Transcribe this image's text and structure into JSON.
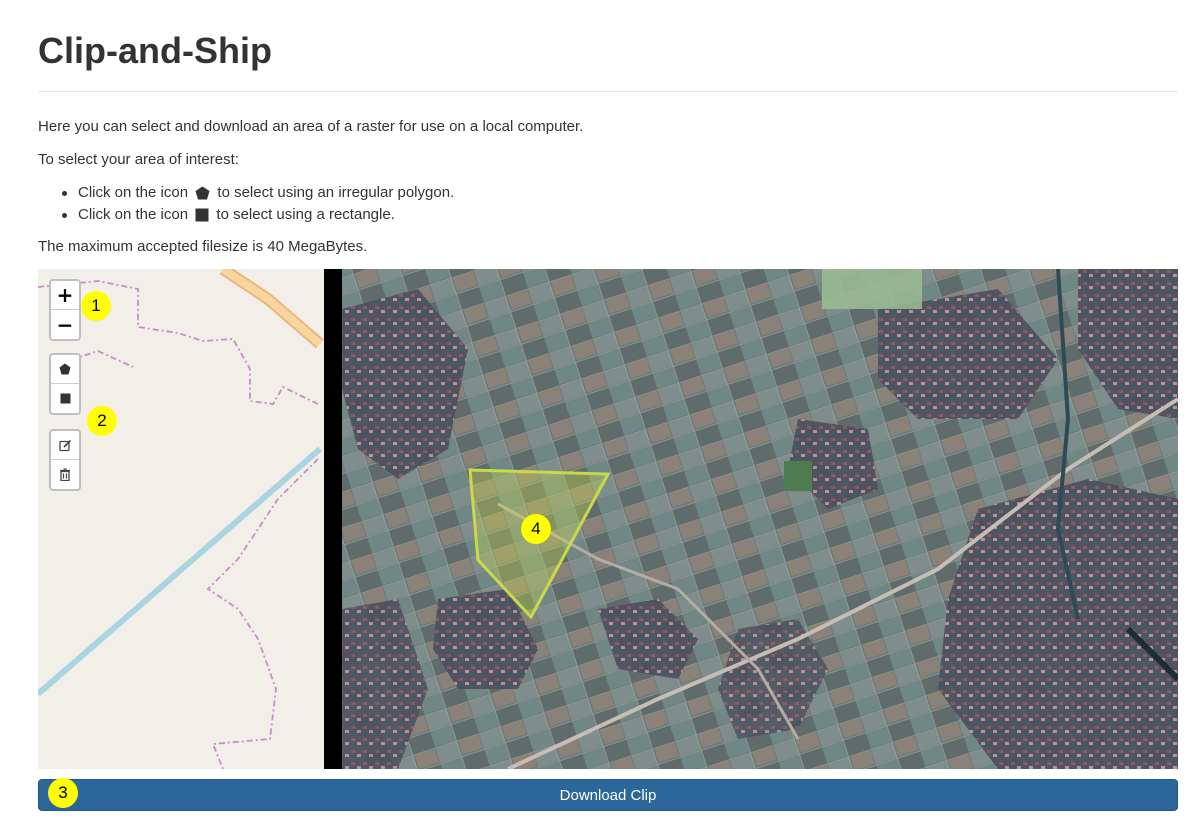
{
  "page": {
    "title": "Clip-and-Ship",
    "intro": "Here you can select and download an area of a raster for use on a local computer.",
    "select_heading": "To select your area of interest:",
    "bullets": [
      {
        "before": "Click on the icon",
        "icon": "polygon-icon",
        "after": "to select using an irregular polygon."
      },
      {
        "before": "Click on the icon",
        "icon": "rectangle-icon",
        "after": "to select using a rectangle."
      }
    ],
    "max_filesize": "The maximum accepted filesize is 40 MegaBytes."
  },
  "map": {
    "controls": {
      "zoom_in": "+",
      "zoom_out": "−",
      "draw_polygon_icon": "polygon-icon",
      "draw_rectangle_icon": "rectangle-icon",
      "edit_icon": "edit-icon",
      "delete_icon": "trash-icon"
    },
    "selection_color": "#c8d94a"
  },
  "markers": [
    "1",
    "2",
    "3",
    "4"
  ],
  "download_button": "Download Clip",
  "colors": {
    "button": "#2b6798",
    "marker": "#ffff00",
    "map_base": "#f2efe9"
  }
}
